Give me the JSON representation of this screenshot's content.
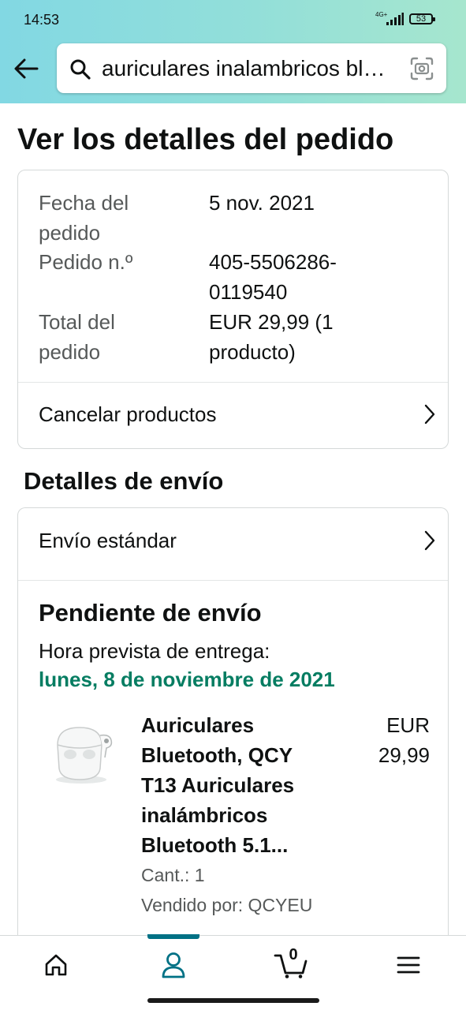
{
  "status_bar": {
    "time": "14:53",
    "network": "4G+",
    "battery": "53"
  },
  "search": {
    "query": "auriculares inalambricos bluetooth"
  },
  "page": {
    "title": "Ver los detalles del pedido"
  },
  "order": {
    "date_label": "Fecha del pedido",
    "date_value": "5 nov. 2021",
    "number_label": "Pedido n.º",
    "number_value": "405-5506286-0119540",
    "total_label": "Total del pedido",
    "total_value": "EUR 29,99 (1 producto)",
    "cancel_label": "Cancelar productos"
  },
  "shipping": {
    "section_title": "Detalles de envío",
    "method_label": "Envío estándar",
    "status": "Pendiente de envío",
    "eta_label": "Hora prevista de entrega:",
    "eta_date": "lunes, 8 de noviembre de 2021"
  },
  "product": {
    "name": "Auriculares Bluetooth, QCY T13 Auriculares inalámbricos Bluetooth 5.1...",
    "price": "EUR 29,99",
    "quantity": "Cant.: 1",
    "seller": "Vendido por: QCYEU"
  },
  "bottom_nav": {
    "items": [
      "home-icon",
      "account-icon",
      "cart-icon",
      "menu-icon"
    ],
    "active": "account-icon",
    "cart_count": "0"
  },
  "colors": {
    "accent_green": "#067d62",
    "active_teal": "#007185",
    "header_gradient": [
      "#82d8e3",
      "#a6e6ce"
    ]
  }
}
